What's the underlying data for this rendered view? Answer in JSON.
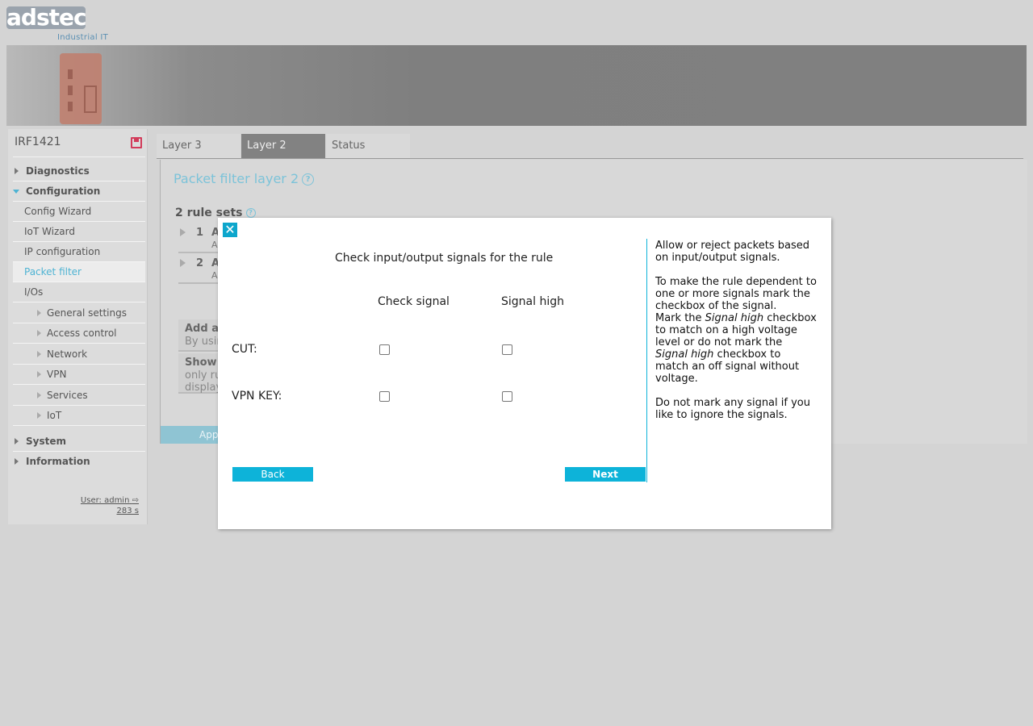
{
  "logo": {
    "text": "adstec",
    "subtitle": "Industrial IT"
  },
  "sidebar": {
    "device_name": "IRF1421",
    "items": [
      {
        "label": "Diagnostics",
        "level": 1
      },
      {
        "label": "Configuration",
        "level": 1,
        "expanded": true
      },
      {
        "label": "Config Wizard",
        "level": 2
      },
      {
        "label": "IoT Wizard",
        "level": 2
      },
      {
        "label": "IP configuration",
        "level": 2
      },
      {
        "label": "Packet filter",
        "level": 2,
        "active": true
      },
      {
        "label": "I/Os",
        "level": 2
      },
      {
        "label": "General settings",
        "level": 3
      },
      {
        "label": "Access control",
        "level": 3
      },
      {
        "label": "Network",
        "level": 3
      },
      {
        "label": "VPN",
        "level": 3
      },
      {
        "label": "Services",
        "level": 3
      },
      {
        "label": "IoT",
        "level": 3
      },
      {
        "label": "System",
        "level": 1
      },
      {
        "label": "Information",
        "level": 1
      }
    ],
    "user": "User: admin",
    "timer": "283 s"
  },
  "tabs": [
    {
      "label": "Layer 3"
    },
    {
      "label": "Layer 2",
      "active": true
    },
    {
      "label": "Status"
    }
  ],
  "content": {
    "title": "Packet filter layer 2",
    "rule_sets": "2 rule sets",
    "rules": [
      {
        "n": "1",
        "a": "A",
        "b": "A"
      },
      {
        "n": "2",
        "a": "A",
        "b": "A"
      }
    ],
    "add": {
      "title": "Add a",
      "sub": "By usin"
    },
    "show": {
      "title": "Show",
      "sub1": "only ru",
      "sub2": "display"
    },
    "apply": "Appl"
  },
  "dialog": {
    "title": "Check input/output signals for the rule",
    "col_check": "Check signal",
    "col_high": "Signal high",
    "signals": [
      {
        "label": "CUT:",
        "check": false,
        "high": false
      },
      {
        "label": "VPN KEY:",
        "check": false,
        "high": false
      }
    ],
    "back": "Back",
    "next": "Next",
    "help_p1": "Allow or reject packets based on input/output signals.",
    "help_p2a": "To make the rule dependent to one or more signals mark the checkbox of the signal.",
    "help_p2b_1": "Mark the ",
    "help_em": "Signal high",
    "help_p2b_2": " checkbox to match on a high voltage level or do not mark the ",
    "help_p2b_3": " checkbox to match an off signal without voltage.",
    "help_p3": "Do not mark any signal if you like to ignore the signals."
  },
  "colors": {
    "accent": "#0db3d9",
    "active_nav": "#4eb3d3",
    "title": "#7cc3d9"
  }
}
